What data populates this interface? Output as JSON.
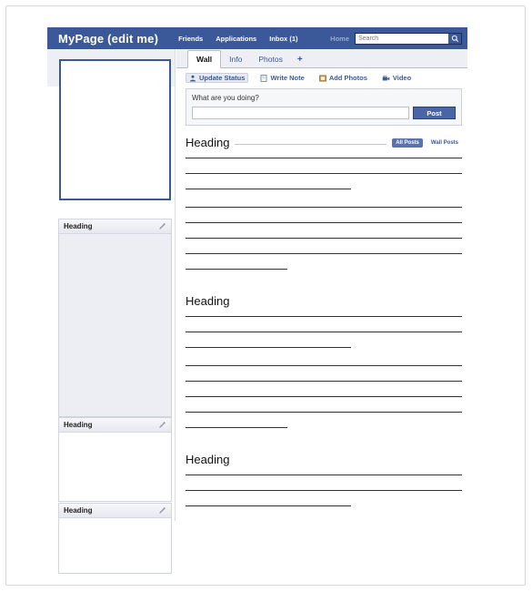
{
  "header": {
    "brand": "MyPage (edit me)",
    "nav": [
      {
        "label": "Friends"
      },
      {
        "label": "Applications"
      },
      {
        "label": "Inbox (1)"
      }
    ],
    "home_label": "Home",
    "search_placeholder": "Search",
    "search_value": "",
    "search_icon": "search-icon",
    "bar_color": "#3b5998"
  },
  "sidebar": {
    "photo_alt": "profile-photo-placeholder",
    "boxes": [
      {
        "title": "Heading",
        "edit_icon": "pencil-icon",
        "style": "filled"
      },
      {
        "title": "Heading",
        "edit_icon": "pencil-icon",
        "style": "plain"
      },
      {
        "title": "Heading",
        "edit_icon": "pencil-icon",
        "style": "plain"
      }
    ]
  },
  "main": {
    "tabs": [
      {
        "label": "Wall",
        "active": true
      },
      {
        "label": "Info",
        "active": false
      },
      {
        "label": "Photos",
        "active": false
      },
      {
        "label": "+",
        "active": false
      }
    ],
    "actions": [
      {
        "label": "Update Status",
        "icon": "person-icon",
        "selected": true
      },
      {
        "label": "Write Note",
        "icon": "note-icon",
        "selected": false
      },
      {
        "label": "Add Photos",
        "icon": "photo-icon",
        "selected": false
      },
      {
        "label": "Video",
        "icon": "video-icon",
        "selected": false
      }
    ],
    "composer": {
      "prompt": "What are you doing?",
      "input_value": "",
      "input_placeholder": "",
      "post_label": "Post"
    },
    "feed": [
      {
        "heading": "Heading",
        "filters": [
          {
            "label": "All Posts",
            "active": true
          },
          {
            "label": "Wall Posts",
            "active": false
          }
        ],
        "paragraphs": [
          {
            "lines": 3,
            "last_short": "short"
          },
          {
            "lines": 4,
            "last_short": "short2"
          }
        ]
      },
      {
        "heading": "Heading",
        "filters": [],
        "paragraphs": [
          {
            "lines": 3,
            "last_short": "short"
          },
          {
            "lines": 4,
            "last_short": "short2"
          }
        ]
      },
      {
        "heading": "Heading",
        "filters": [],
        "paragraphs": [
          {
            "lines": 3,
            "last_short": "short"
          }
        ]
      }
    ]
  }
}
